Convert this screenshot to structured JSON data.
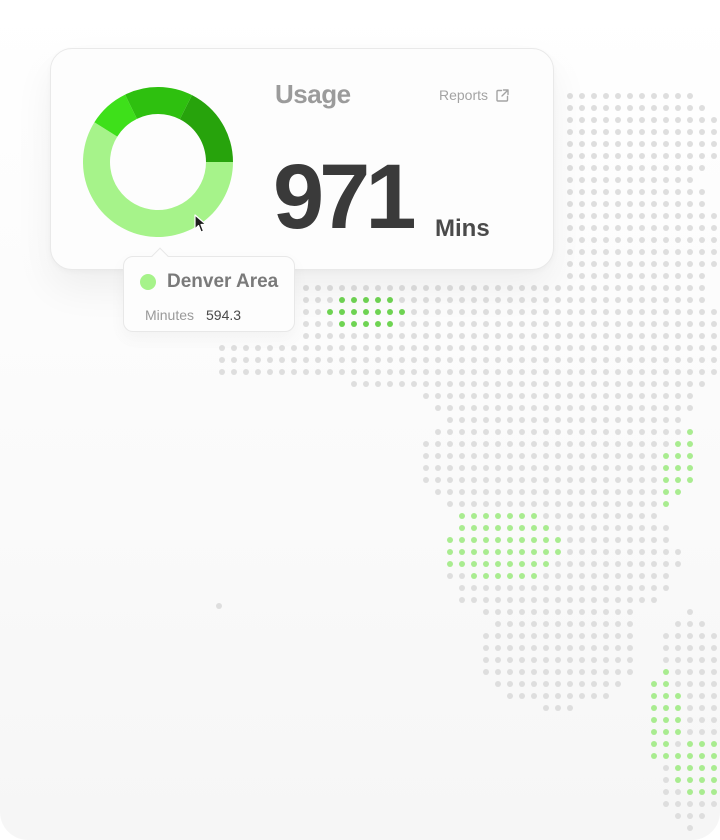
{
  "card": {
    "title": "Usage",
    "reports_label": "Reports",
    "reports_icon": "external-link-icon",
    "total_value": "971",
    "total_unit": "Mins"
  },
  "donut": {
    "segments": [
      {
        "color": "#a6f38a"
      },
      {
        "color": "#3ee01a"
      },
      {
        "color": "#2ec00f"
      },
      {
        "color": "#27a30c"
      }
    ],
    "highlighted_color": "#a6f38a"
  },
  "tooltip": {
    "region": "Denver Area",
    "metric_label": "Minutes",
    "metric_value": "594.3",
    "swatch_color": "#a6f38a"
  },
  "colors": {
    "dot_gray": "#dedede",
    "dot_green_light": "#a9ec90",
    "dot_green_dark": "#6fd453"
  }
}
